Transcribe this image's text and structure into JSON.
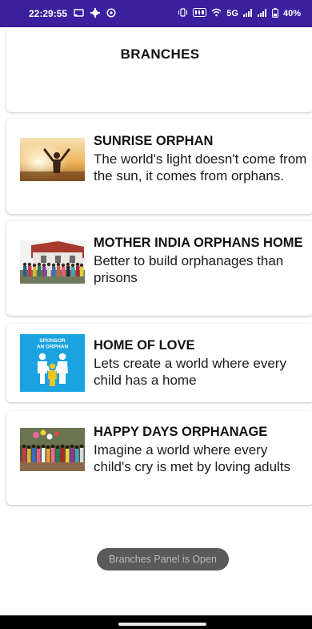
{
  "status_bar": {
    "time": "22:29:55",
    "left_icons": [
      "cast-icon",
      "gear-icon",
      "vpn-icon"
    ],
    "right_text": "5G",
    "battery": "40%"
  },
  "header": {
    "title": "BRANCHES"
  },
  "branches": [
    {
      "name": "SUNRISE ORPHAN",
      "description": "The world's light doesn't come from the sun, it comes from orphans.",
      "image": "sunrise-child-photo"
    },
    {
      "name": "MOTHER INDIA ORPHANS HOME",
      "description": "Better to build orphanages than prisons",
      "image": "group-photo-house"
    },
    {
      "name": "HOME OF LOVE",
      "description": "Lets create a world where every child has a home",
      "image": "sponsor-an-orphan-graphic",
      "image_text": "SPONSOR AN ORPHAN"
    },
    {
      "name": "HAPPY DAYS ORPHANAGE",
      "description": "Imagine a world where every child's cry is met by loving adults",
      "image": "children-group-photo"
    }
  ],
  "toast": {
    "text": "Branches Panel is Open"
  },
  "colors": {
    "status_bar_bg": "#3a1f9e",
    "sponsor_bg": "#1aa3e0",
    "toast_bg": "#5a5a5a"
  }
}
